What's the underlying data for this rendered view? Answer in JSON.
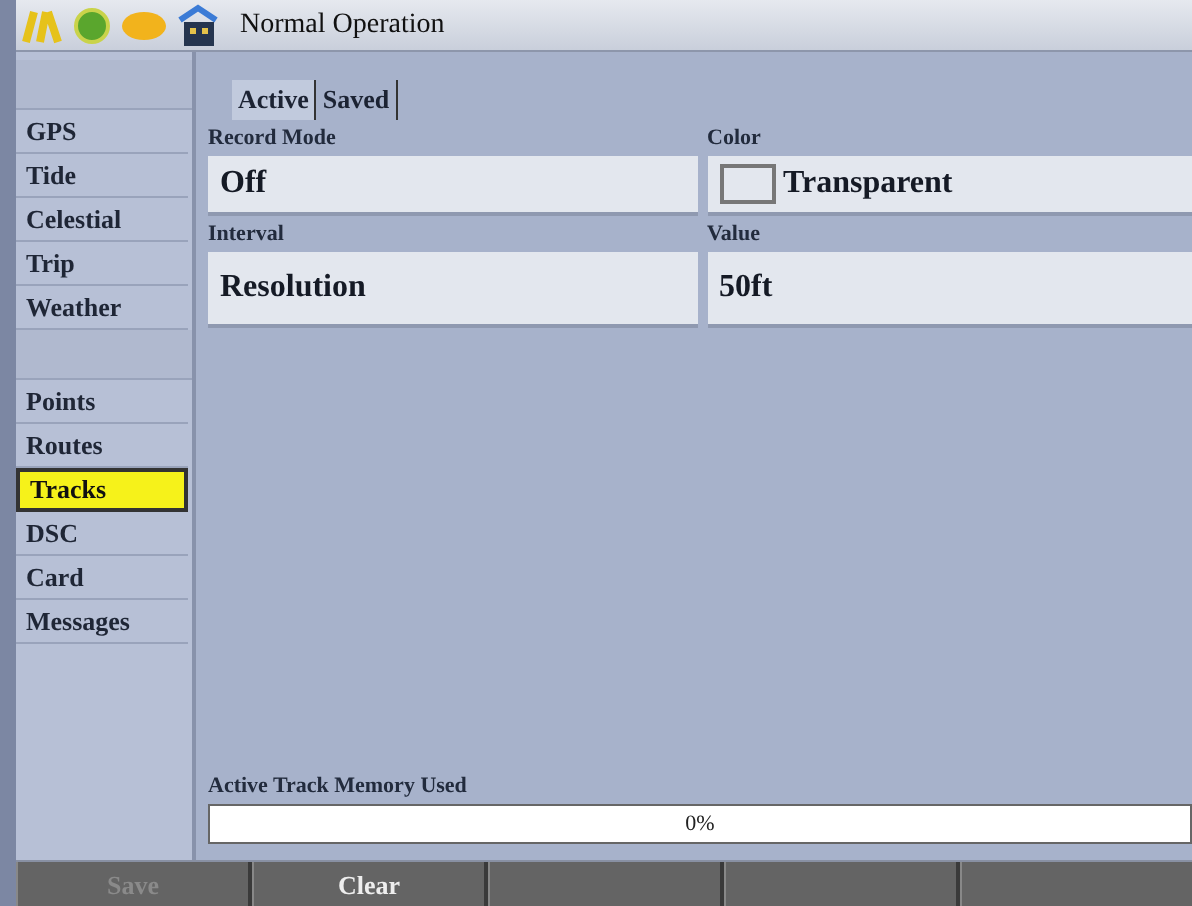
{
  "title_bar": {
    "title": "Normal Operation"
  },
  "sidebar": {
    "items": [
      {
        "kind": "separator"
      },
      {
        "kind": "item",
        "label": "GPS",
        "selected": false
      },
      {
        "kind": "item",
        "label": "Tide",
        "selected": false
      },
      {
        "kind": "item",
        "label": "Celestial",
        "selected": false
      },
      {
        "kind": "item",
        "label": "Trip",
        "selected": false
      },
      {
        "kind": "item",
        "label": "Weather",
        "selected": false
      },
      {
        "kind": "separator"
      },
      {
        "kind": "item",
        "label": "Points",
        "selected": false
      },
      {
        "kind": "item",
        "label": "Routes",
        "selected": false
      },
      {
        "kind": "item",
        "label": "Tracks",
        "selected": true
      },
      {
        "kind": "item",
        "label": "DSC",
        "selected": false
      },
      {
        "kind": "item",
        "label": "Card",
        "selected": false
      },
      {
        "kind": "item",
        "label": "Messages",
        "selected": false
      }
    ]
  },
  "tabs": [
    {
      "label": "Active",
      "selected": true
    },
    {
      "label": "Saved",
      "selected": false
    }
  ],
  "fields": [
    {
      "kind": "text",
      "label": "Record Mode",
      "value": "Off"
    },
    {
      "kind": "color",
      "label": "Color",
      "value": "Transparent"
    },
    {
      "kind": "text",
      "label": "Interval",
      "value": "Resolution"
    },
    {
      "kind": "text",
      "label": "Value",
      "value": "50ft"
    }
  ],
  "memory": {
    "label": "Active Track Memory Used",
    "level": 0,
    "reading": "0%"
  },
  "softkeys": [
    {
      "kind": "key",
      "label": "Save",
      "disabled": true
    },
    {
      "kind": "key",
      "label": "Clear",
      "disabled": false
    },
    {
      "kind": "blank"
    },
    {
      "kind": "blank"
    },
    {
      "kind": "blank"
    }
  ]
}
